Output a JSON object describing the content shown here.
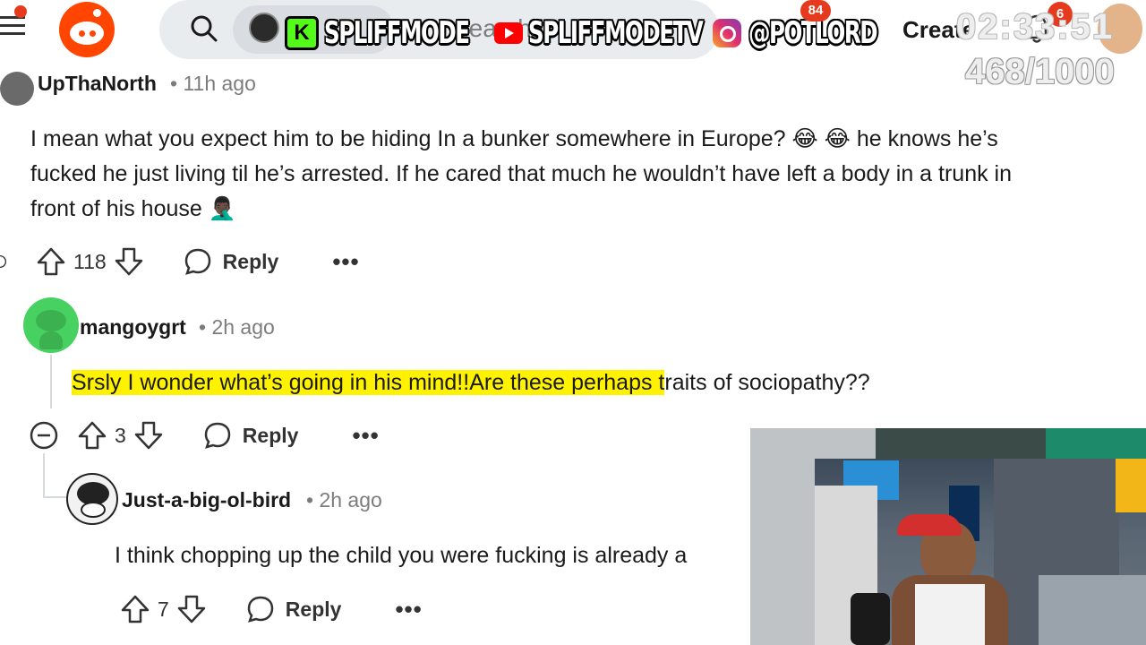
{
  "header": {
    "search_placeholder": "Search i",
    "overlay_kick": "SPLIFFMODE",
    "kick_letter": "K",
    "overlay_youtube": "SPLIFFMODETV",
    "overlay_instagram": "@POTLORD",
    "chat_count": "84",
    "create_label": "Create",
    "timer": "02:33:51",
    "counter": "468/1000",
    "notification_count": "6"
  },
  "comments": [
    {
      "author": "UpThaNorth",
      "time": "• 11h ago",
      "body_line1": "I mean what you expect him to be hiding In a bunker somewhere in Europe? 😂 😂 he knows he’s",
      "body_line2": "fucked he just living til he’s arrested. If he cared that much he wouldn’t have left a body in a trunk in",
      "body_line3": "front of his house 🤦🏿‍♂️",
      "score": "118",
      "reply_label": "Reply",
      "more_label": "•••"
    },
    {
      "author": "mangoygrt",
      "time": "• 2h ago",
      "body_highlighted": "Srsly I wonder what’s going in his mind!!Are these perhaps t",
      "body_rest": "raits of sociopathy??",
      "score": "3",
      "reply_label": "Reply",
      "more_label": "•••"
    },
    {
      "author": "Just-a-big-ol-bird",
      "time": "• 2h ago",
      "body": "I think chopping up the child you were fucking is already a",
      "score": "7",
      "reply_label": "Reply",
      "more_label": "•••"
    }
  ],
  "colors": {
    "reddit_orange": "#ff4500",
    "highlight": "#fff200",
    "badge_red": "#e63a1e"
  }
}
